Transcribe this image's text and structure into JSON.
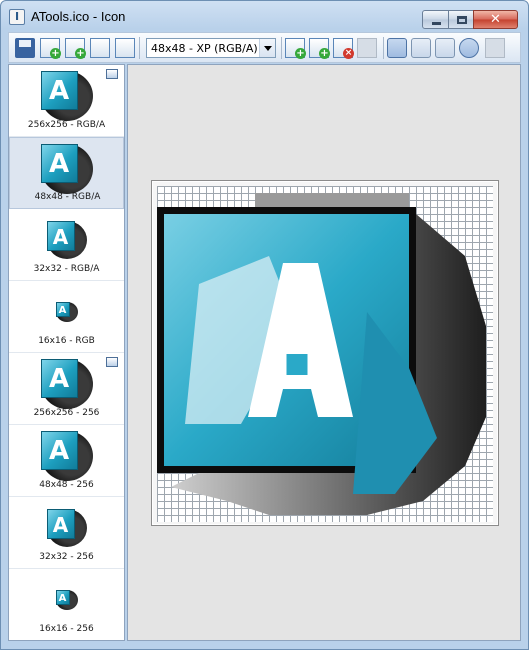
{
  "window": {
    "title": "ATools.ico - Icon",
    "controls": {
      "close": "✕"
    }
  },
  "toolbar": {
    "format_select": {
      "value": "48x48 - XP (RGB/A)"
    }
  },
  "sidebar": {
    "items": [
      {
        "label": "256x256 - RGB/A",
        "selected": false,
        "badge": true
      },
      {
        "label": "48x48 - RGB/A",
        "selected": true,
        "badge": false
      },
      {
        "label": "32x32 - RGB/A",
        "selected": false,
        "badge": false
      },
      {
        "label": "16x16 - RGB",
        "selected": false,
        "badge": false
      },
      {
        "label": "256x256 - 256",
        "selected": false,
        "badge": true
      },
      {
        "label": "48x48 - 256",
        "selected": false,
        "badge": false
      },
      {
        "label": "32x32 - 256",
        "selected": false,
        "badge": false
      },
      {
        "label": "16x16 - 256",
        "selected": false,
        "badge": false
      }
    ],
    "thumb_glyph": "A"
  },
  "editor": {
    "canvas_glyph": "A",
    "pixel_grid": "48x48"
  },
  "colors": {
    "accent_teal": "#1d9fbf",
    "dark_gray": "#2b2b2b",
    "selection_bg": "#dde5f0"
  }
}
